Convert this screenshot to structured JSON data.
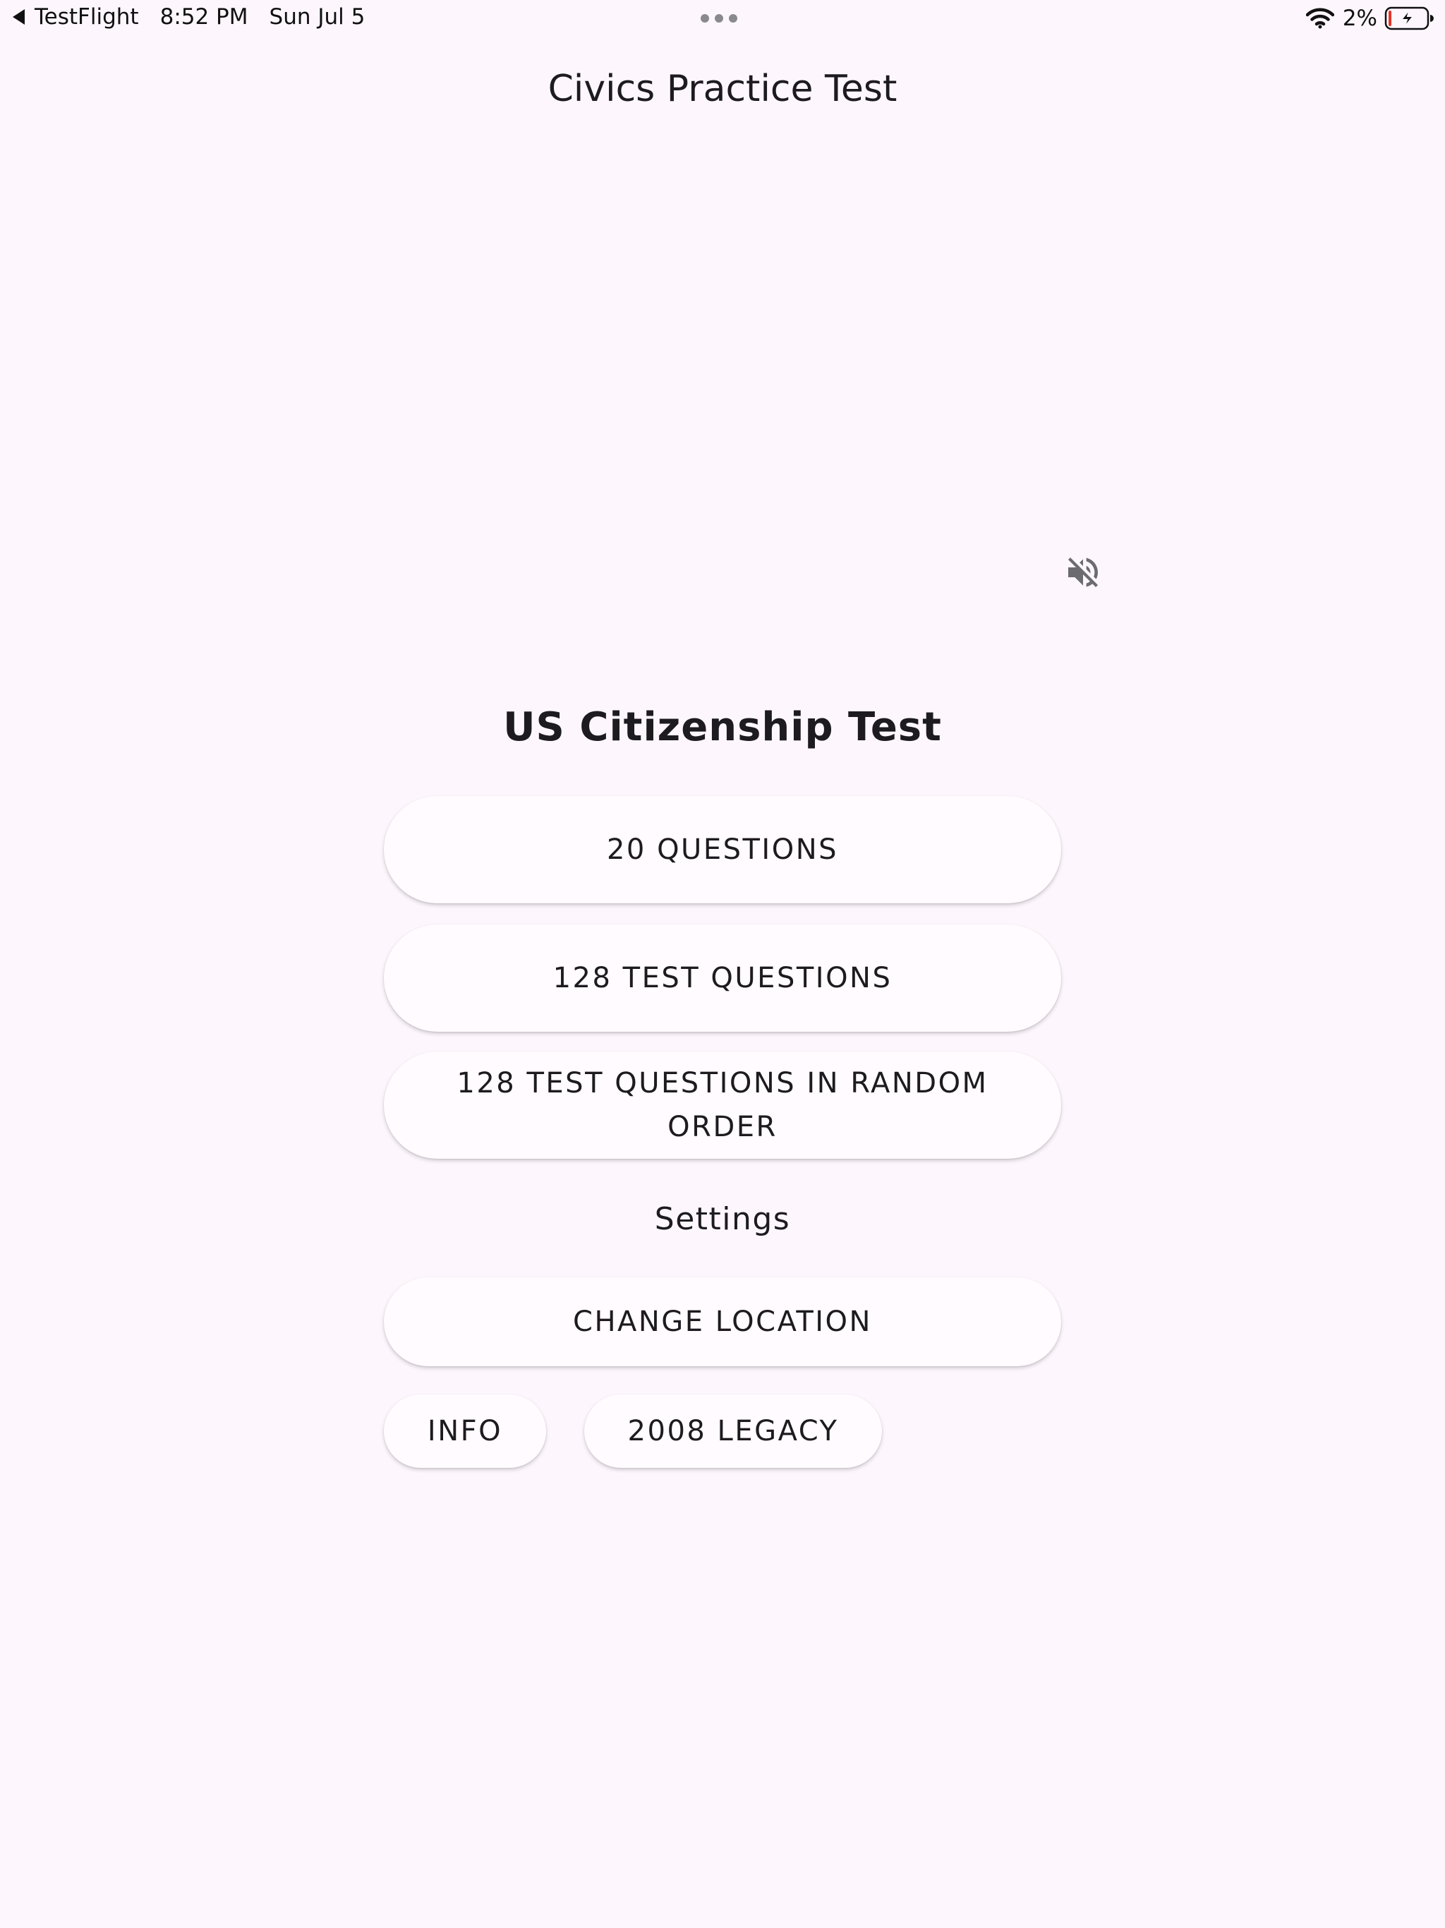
{
  "status_bar": {
    "back_app": "TestFlight",
    "time": "8:52 PM",
    "date": "Sun Jul 5",
    "battery_percent": "2%",
    "battery_level": 0.02,
    "battery_low_color": "#e5332a",
    "charging": true
  },
  "app_bar": {
    "title": "Civics Practice Test"
  },
  "audio": {
    "icon": "volume-off-icon",
    "muted": true
  },
  "main": {
    "heading": "US Citizenship Test",
    "buttons": {
      "twenty_questions": "20 QUESTIONS",
      "all_questions": "128 TEST QUESTIONS",
      "random_questions": "128 TEST QUESTIONS IN RANDOM ORDER"
    },
    "settings_label": "Settings",
    "settings_buttons": {
      "change_location": "CHANGE LOCATION",
      "info": "INFO",
      "legacy": "2008 LEGACY"
    }
  },
  "colors": {
    "background": "#fdf7fd",
    "button_surface": "#fffbff",
    "text": "#1d1b20"
  }
}
